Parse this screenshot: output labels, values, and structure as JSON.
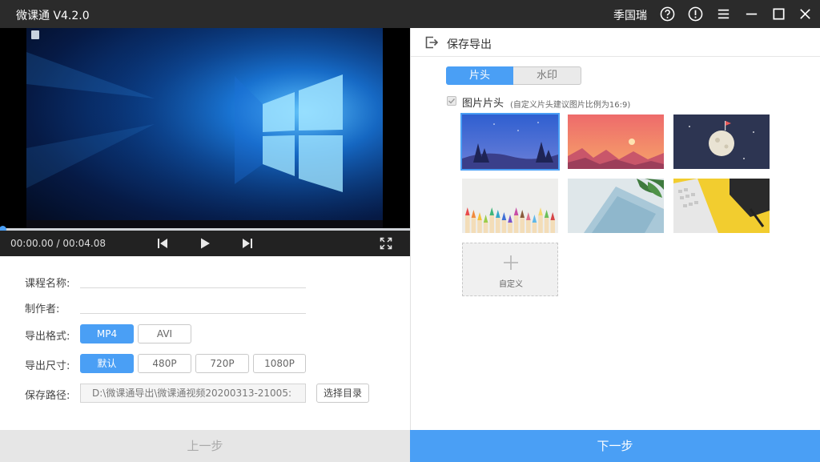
{
  "titlebar": {
    "app_title": "微课通 V4.2.0",
    "username": "季国瑞",
    "icons": [
      "help-icon",
      "alert-icon",
      "menu-icon",
      "minimize-icon",
      "maximize-icon",
      "close-icon"
    ]
  },
  "player": {
    "timecode": "00:00.00 / 00:04.08",
    "progress_percent": 0
  },
  "form": {
    "course_name_label": "课程名称:",
    "course_name_value": "",
    "author_label": "制作者:",
    "author_value": "",
    "format_label": "导出格式:",
    "formats": [
      "MP4",
      "AVI"
    ],
    "selected_format": "MP4",
    "size_label": "导出尺寸:",
    "sizes": [
      "默认",
      "480P",
      "720P",
      "1080P"
    ],
    "selected_size": "默认",
    "path_label": "保存路径:",
    "path_value": "D:\\微课通导出\\微课通视频20200313-21005:",
    "choose_dir_label": "选择目录"
  },
  "footer": {
    "prev_label": "上一步",
    "next_label": "下一步"
  },
  "export_panel": {
    "title": "保存导出",
    "tabs": [
      "片头",
      "水印"
    ],
    "active_tab": "片头",
    "image_intro_label": "图片片头",
    "image_intro_hint": "(自定义片头建议图片比例为16:9)",
    "image_intro_checked": true,
    "custom_label": "自定义",
    "thumbnails": [
      "night-sky-forest",
      "sunset-mountains",
      "moon-space",
      "colored-pencils",
      "notebook-plant",
      "keyboard-yellow"
    ],
    "selected_thumbnail": "night-sky-forest"
  },
  "colors": {
    "accent": "#4a9ff5",
    "titlebar": "#2b2b2b",
    "controlbar": "#222222"
  }
}
